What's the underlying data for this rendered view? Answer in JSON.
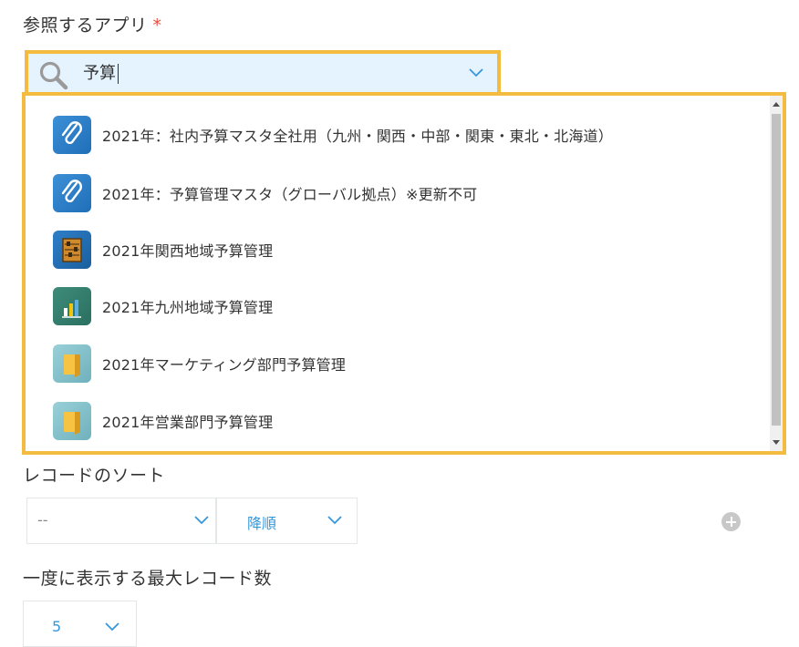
{
  "app_field": {
    "label": "参照するアプリ",
    "required_mark": "*",
    "search": {
      "value": "予算"
    }
  },
  "dropdown": {
    "items": [
      {
        "icon": "paperclip-icon",
        "label": "2021年：社内予算マスタ全社用（九州・関西・中部・関東・東北・北海道）"
      },
      {
        "icon": "paperclip-icon",
        "label": "2021年：予算管理マスタ（グローバル拠点）※更新不可"
      },
      {
        "icon": "abacus-icon",
        "label": "2021年関西地域予算管理"
      },
      {
        "icon": "bar-chart-icon",
        "label": "2021年九州地域予算管理"
      },
      {
        "icon": "folder-icon",
        "label": "2021年マーケティング部門予算管理"
      },
      {
        "icon": "folder-icon",
        "label": "2021年営業部門予算管理"
      }
    ]
  },
  "sort": {
    "label": "レコードのソート",
    "field_value": "--",
    "order_value": "降順"
  },
  "max_records": {
    "label": "一度に表示する最大レコード数",
    "value": "5"
  },
  "colors": {
    "highlight": "#f3bb3f",
    "search_bg": "#e5f3ff",
    "accent_blue": "#3498db",
    "required": "#e74c3c"
  }
}
